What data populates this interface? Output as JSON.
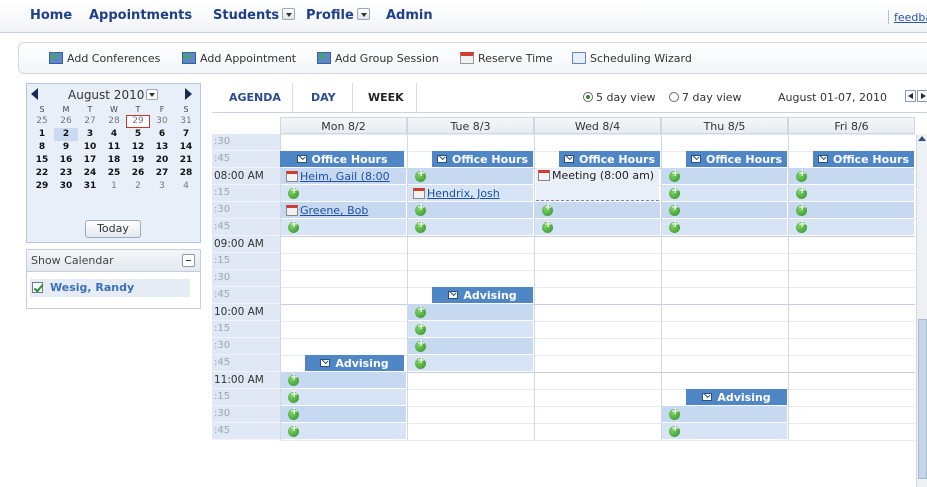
{
  "nav": {
    "home": "Home",
    "appointments": "Appointments",
    "students": "Students",
    "profile": "Profile",
    "admin": "Admin",
    "feedback": "feedba"
  },
  "toolbar": {
    "add_conferences": "Add Conferences",
    "add_appointment": "Add Appointment",
    "add_group_session": "Add Group Session",
    "reserve_time": "Reserve Time",
    "scheduling_wizard": "Scheduling Wizard"
  },
  "mini_calendar": {
    "month": "August 2010",
    "dows": [
      "S",
      "M",
      "T",
      "W",
      "T",
      "F",
      "S"
    ],
    "weeks": [
      [
        "25",
        "26",
        "27",
        "28",
        "29",
        "30",
        "31"
      ],
      [
        "1",
        "2",
        "3",
        "4",
        "5",
        "6",
        "7"
      ],
      [
        "8",
        "9",
        "10",
        "11",
        "12",
        "13",
        "14"
      ],
      [
        "15",
        "16",
        "17",
        "18",
        "19",
        "20",
        "21"
      ],
      [
        "22",
        "23",
        "24",
        "25",
        "26",
        "27",
        "28"
      ],
      [
        "29",
        "30",
        "31",
        "1",
        "2",
        "3",
        "4"
      ]
    ],
    "today_label": "Today"
  },
  "show_calendar": {
    "title": "Show Calendar",
    "calendars": [
      "Wesig, Randy"
    ]
  },
  "views": {
    "agenda": "AGENDA",
    "day": "DAY",
    "week": "WEEK",
    "five_day": "5 day view",
    "seven_day": "7 day view",
    "range": "August 01-07, 2010"
  },
  "days": [
    "Mon 8/2",
    "Tue 8/3",
    "Wed 8/4",
    "Thu 8/5",
    "Fri 8/6"
  ],
  "times": [
    ":30",
    ":45",
    "08:00 AM",
    ":15",
    ":30",
    ":45",
    "09:00 AM",
    ":15",
    ":30",
    ":45",
    "10:00 AM",
    ":15",
    ":30",
    ":45",
    "11:00 AM",
    ":15",
    ":30",
    ":45"
  ],
  "events": {
    "office_hours": "Office Hours",
    "advising": "Advising",
    "heim": "Heim, Gail (8:00",
    "hendrix": "Hendrix, Josh",
    "greene": "Greene, Bob",
    "meeting": "Meeting (8:00 am)"
  }
}
